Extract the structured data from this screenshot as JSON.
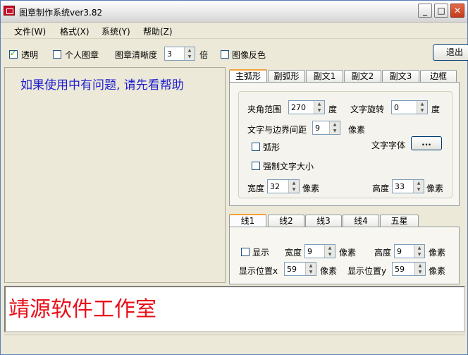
{
  "window": {
    "title": "图章制作系统ver3.82"
  },
  "menu": [
    "文件(W)",
    "格式(X)",
    "系统(Y)",
    "帮助(Z)"
  ],
  "toolbar": {
    "transparent_label": "透明",
    "transparent_checked": true,
    "personal_label": "个人图章",
    "personal_checked": false,
    "clarity_label": "图章清晰度",
    "clarity_value": "3",
    "clarity_unit": "倍",
    "invert_label": "图像反色",
    "invert_checked": false,
    "exit_label": "退出"
  },
  "left": {
    "notice": "如果使用中有问题, 请先看帮助"
  },
  "main_tabs": [
    "主弧形",
    "副弧形",
    "副文1",
    "副文2",
    "副文3",
    "边框"
  ],
  "arc_panel": {
    "angle_label": "夹角范围",
    "angle_value": "270",
    "angle_unit": "度",
    "rotate_label": "文字旋转",
    "rotate_value": "0",
    "rotate_unit": "度",
    "margin_label": "文字与边界间距",
    "margin_value": "9",
    "margin_unit": "像素",
    "arc_label": "弧形",
    "font_label": "文字字体",
    "font_button": "...",
    "force_size_label": "强制文字大小",
    "width_label": "宽度",
    "width_value": "32",
    "width_unit": "像素",
    "height_label": "高度",
    "height_value": "33",
    "height_unit": "像素"
  },
  "line_tabs": [
    "线1",
    "线2",
    "线3",
    "线4",
    "五星"
  ],
  "line_panel": {
    "show_label": "显示",
    "width_label": "宽度",
    "width_value": "9",
    "width_unit": "像素",
    "height_label": "高度",
    "height_value": "9",
    "height_unit": "像素",
    "posx_label": "显示位置x",
    "posx_value": "59",
    "posx_unit": "像素",
    "posy_label": "显示位置y",
    "posy_value": "59",
    "posy_unit": "像素"
  },
  "preview": {
    "text": "靖源软件工作室"
  }
}
